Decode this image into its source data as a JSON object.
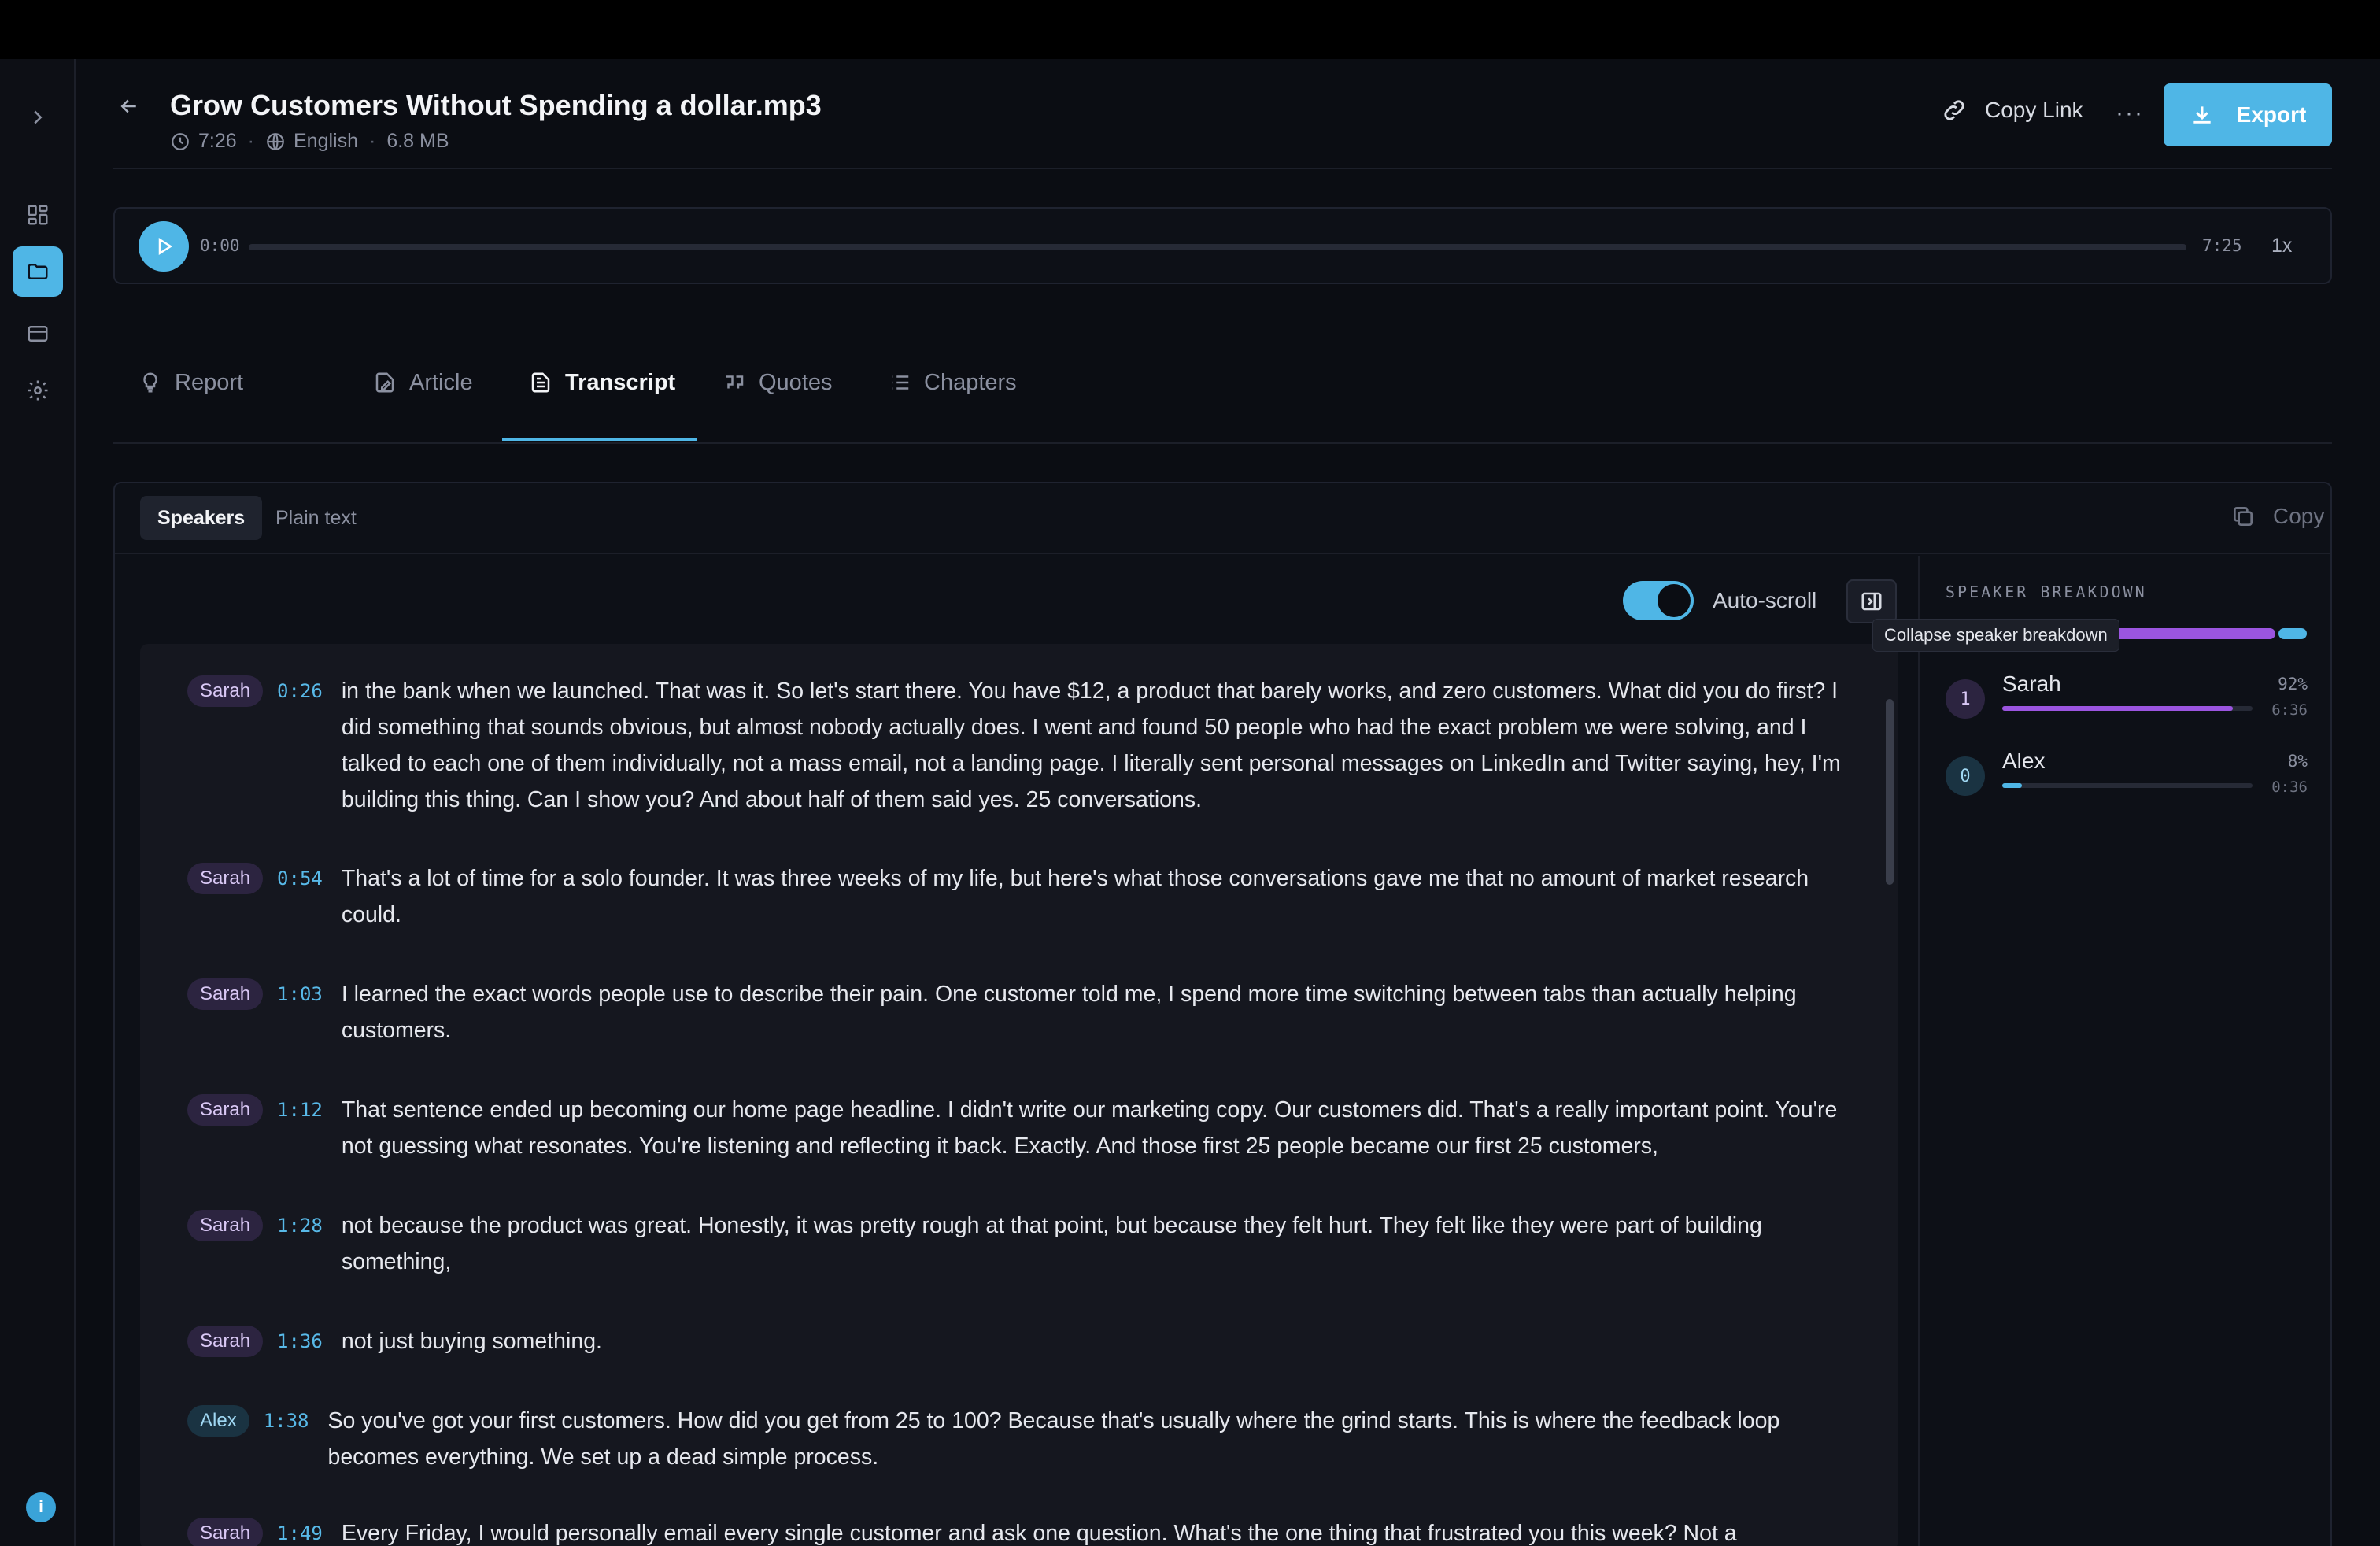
{
  "file": {
    "title": "Grow Customers Without Spending a dollar.mp3",
    "duration": "7:26",
    "language": "English",
    "size": "6.8 MB"
  },
  "header": {
    "copy_link_label": "Copy Link",
    "more_label": "···",
    "export_label": "Export"
  },
  "player": {
    "current_time": "0:00",
    "total_time": "7:25",
    "speed": "1x",
    "progress": 0
  },
  "tabs": [
    {
      "label": "Report",
      "icon": "lightbulb-icon"
    },
    {
      "label": "Article",
      "icon": "article-icon"
    },
    {
      "label": "Transcript",
      "icon": "document-icon",
      "active": true
    },
    {
      "label": "Quotes",
      "icon": "quote-icon"
    },
    {
      "label": "Chapters",
      "icon": "list-icon"
    }
  ],
  "transcript": {
    "view_modes": [
      "Speakers",
      "Plain text"
    ],
    "active_view": "Speakers",
    "copy_label": "Copy",
    "auto_scroll_label": "Auto-scroll",
    "auto_scroll_on": true,
    "collapse_tooltip": "Collapse speaker breakdown",
    "segments": [
      {
        "speaker": "Sarah",
        "time": "0:26",
        "text": "in the bank when we launched. That was it. So let's start there. You have $12, a product that barely works, and zero customers. What did you do first? I did something that sounds obvious, but almost nobody actually does. I went and found 50 people who had the exact problem we were solving, and I talked to each one of them individually, not a mass email, not a landing page. I literally sent personal messages on LinkedIn and Twitter saying, hey, I'm building this thing. Can I show you? And about half of them said yes. 25 conversations."
      },
      {
        "speaker": "Sarah",
        "time": "0:54",
        "text": "That's a lot of time for a solo founder. It was three weeks of my life, but here's what those conversations gave me that no amount of market research could."
      },
      {
        "speaker": "Sarah",
        "time": "1:03",
        "text": "I learned the exact words people use to describe their pain. One customer told me, I spend more time switching between tabs than actually helping customers."
      },
      {
        "speaker": "Sarah",
        "time": "1:12",
        "text": "That sentence ended up becoming our home page headline. I didn't write our marketing copy. Our customers did. That's a really important point. You're not guessing what resonates. You're listening and reflecting it back. Exactly. And those first 25 people became our first 25 customers,"
      },
      {
        "speaker": "Sarah",
        "time": "1:28",
        "text": "not because the product was great. Honestly, it was pretty rough at that point, but because they felt hurt. They felt like they were part of building something,"
      },
      {
        "speaker": "Sarah",
        "time": "1:36",
        "text": "not just buying something."
      },
      {
        "speaker": "Alex",
        "time": "1:38",
        "text": "So you've got your first customers. How did you get from 25 to 100? Because that's usually where the grind starts. This is where the feedback loop becomes everything. We set up a dead simple process."
      },
      {
        "speaker": "Sarah",
        "time": "1:49",
        "text": "Every Friday, I would personally email every single customer and ask one question. What's the one thing that frustrated you this week? Not a"
      }
    ]
  },
  "breakdown": {
    "title": "SPEAKER BREAKDOWN",
    "speakers": [
      {
        "id": "1",
        "name": "Sarah",
        "percent": "92%",
        "share": 0.92,
        "duration": "6:36",
        "color": "#9b55e0"
      },
      {
        "id": "0",
        "name": "Alex",
        "percent": "8%",
        "share": 0.08,
        "duration": "0:36",
        "color": "#4fb6e6"
      }
    ]
  },
  "sidebar": {
    "items": [
      "expand-icon",
      "dashboard-icon",
      "folder-icon",
      "billing-icon",
      "settings-icon"
    ],
    "info_label": "i"
  }
}
